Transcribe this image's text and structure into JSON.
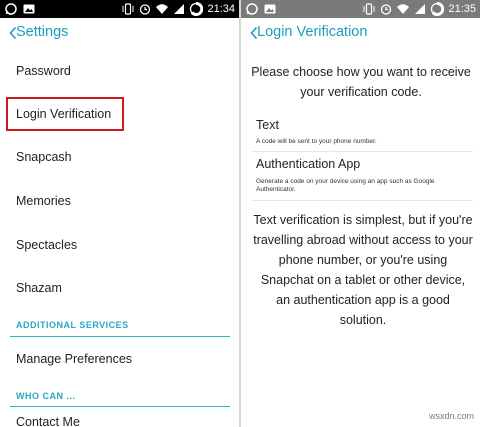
{
  "left_panel": {
    "status_bar": {
      "time": "21:34"
    },
    "header": {
      "title": "Settings"
    },
    "items": [
      {
        "label": "Password"
      },
      {
        "label": "Login Verification"
      },
      {
        "label": "Snapcash"
      },
      {
        "label": "Memories"
      },
      {
        "label": "Spectacles"
      },
      {
        "label": "Shazam"
      }
    ],
    "sections": [
      {
        "title": "ADDITIONAL SERVICES"
      },
      {
        "title": "WHO CAN ..."
      }
    ],
    "manage_preferences": "Manage Preferences",
    "contact_me": "Contact Me"
  },
  "right_panel": {
    "status_bar": {
      "time": "21:35"
    },
    "header": {
      "title": "Login Verification"
    },
    "intro": "Please choose how you want to receive your verification code.",
    "options": [
      {
        "title": "Text",
        "description": "A code will be sent to your phone number."
      },
      {
        "title": "Authentication App",
        "description": "Generate a code on your device using an app such as Google Authenticator."
      }
    ],
    "explanation": "Text verification is simplest, but if you're travelling abroad without access to your phone number, or you're using Snapchat on a tablet or other device, an authentication app is a good solution."
  },
  "watermark": "wsxdn.com",
  "colors": {
    "accent": "#1a9fba",
    "highlight": "#d0191f",
    "left_status_bar": "#000000",
    "right_status_bar": "#7a7a7a"
  }
}
